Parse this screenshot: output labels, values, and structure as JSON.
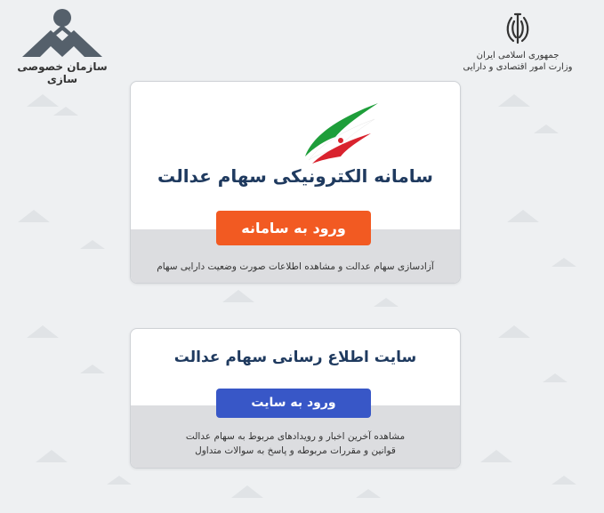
{
  "header": {
    "org_name": "سازمان خصوصی سازی",
    "gov_line1": "جمهوری اسلامی ایران",
    "gov_line2": "وزارت امور اقتصادی و دارایی"
  },
  "card_system": {
    "title": "سامانه الکترونیکی سهام عدالت",
    "button_label": "ورود به سامانه",
    "description": "آزادسازی سهام عدالت و مشاهده اطلاعات صورت وضعیت دارایی سهام",
    "button_color": "#f25a22"
  },
  "card_site": {
    "title": "سایت اطلاع رسانی سهام عدالت",
    "button_label": "ورود به سایت",
    "description_line1": "مشاهده آخرین اخبار و رویدادهای مربوط به سهام عدالت",
    "description_line2": "قوانین و مقررات مربوطه و پاسخ به سوالات متداول",
    "button_color": "#3857c7"
  },
  "icons": [
    "privatization-logo-icon",
    "iran-emblem-icon",
    "iran-flag-icon"
  ]
}
